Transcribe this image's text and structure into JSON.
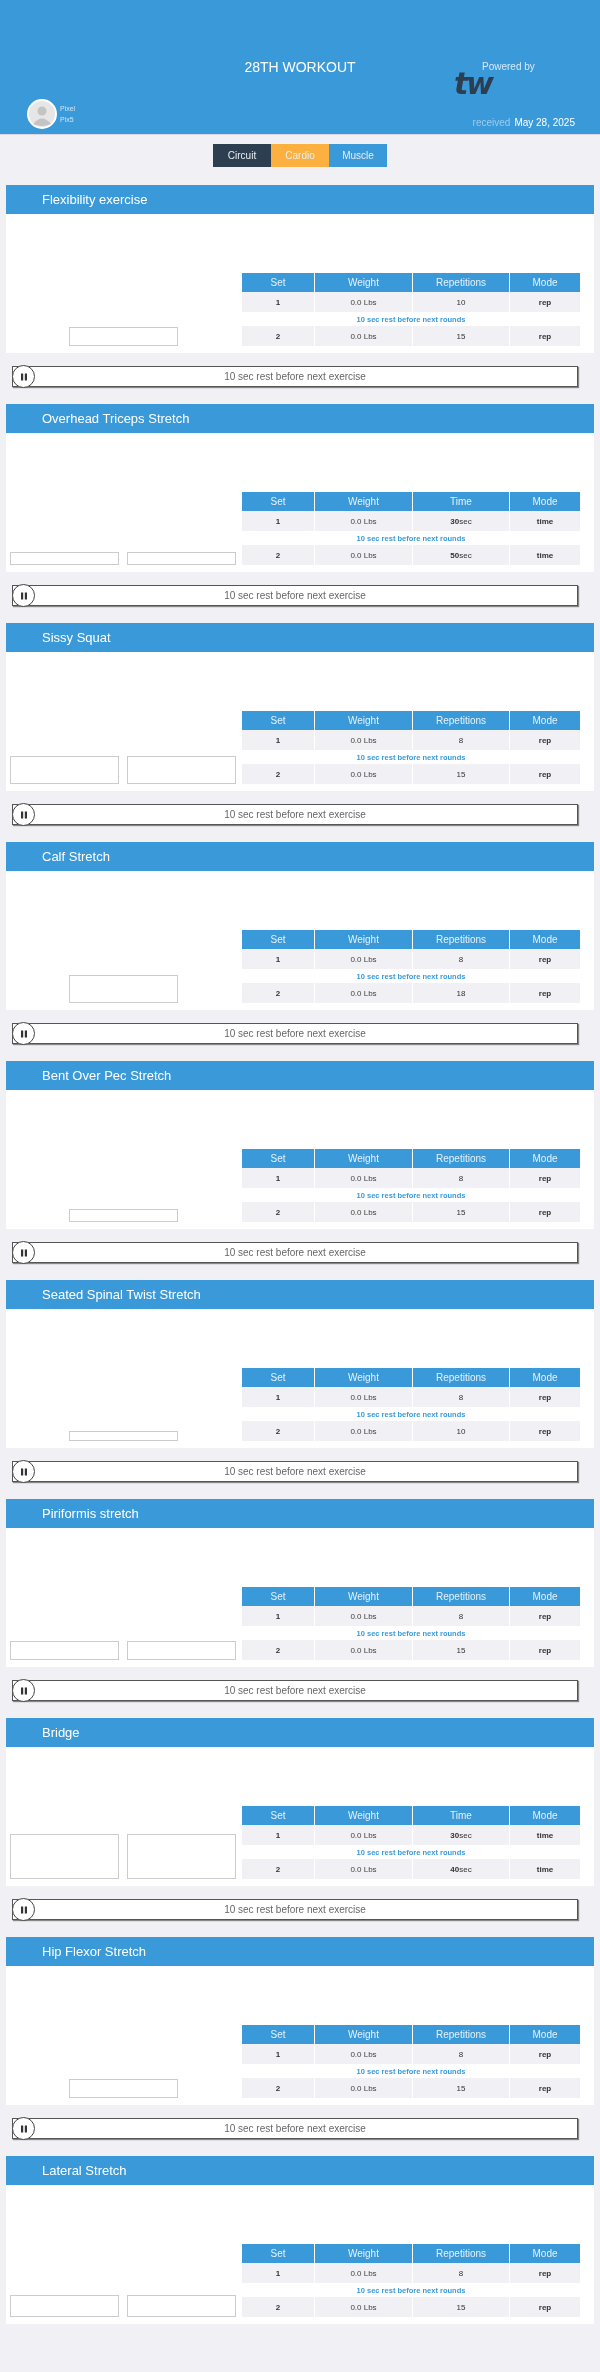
{
  "header": {
    "title": "28TH WORKOUT",
    "user_first": "Pixel",
    "user_last": "Pix5",
    "powered_by": "Powered by",
    "logo_text": "tw",
    "received_label": "received",
    "received_date": "May 28, 2025"
  },
  "tabs": [
    {
      "label": "Circuit",
      "color": "#2c3e50"
    },
    {
      "label": "Cardio",
      "color": "#fbb040"
    },
    {
      "label": "Muscle",
      "color": "#3a9ad9"
    }
  ],
  "exercises": [
    {
      "name": "Flexibility exercise",
      "images": [
        {
          "kind": "short"
        }
      ],
      "columns": [
        "Set",
        "Weight",
        "Repetitions",
        "Mode"
      ],
      "rows": [
        {
          "kind": "set",
          "set": "1",
          "weight": "0.0 Lbs",
          "amount": "10",
          "mode": "rep"
        },
        {
          "kind": "rest",
          "text": "10 sec rest before next rounds"
        },
        {
          "kind": "set",
          "set": "2",
          "weight": "0.0 Lbs",
          "amount": "15",
          "mode": "rep"
        }
      ],
      "rest_after": "10 sec rest before next exercise"
    },
    {
      "name": "Overhead Triceps Stretch",
      "images": [
        {
          "kind": "thin"
        },
        {
          "kind": "thin"
        }
      ],
      "columns": [
        "Set",
        "Weight",
        "Time",
        "Mode"
      ],
      "rows": [
        {
          "kind": "set",
          "set": "1",
          "weight": "0.0 Lbs",
          "amount": "**30**sec",
          "mode": "time"
        },
        {
          "kind": "rest",
          "text": "10 sec rest before next rounds"
        },
        {
          "kind": "set",
          "set": "2",
          "weight": "0.0 Lbs",
          "amount": "**50**sec",
          "mode": "time"
        }
      ],
      "rest_after": "10 sec rest before next exercise"
    },
    {
      "name": "Sissy Squat",
      "images": [
        {
          "kind": "medium"
        },
        {
          "kind": "medium"
        }
      ],
      "columns": [
        "Set",
        "Weight",
        "Repetitions",
        "Mode"
      ],
      "rows": [
        {
          "kind": "set",
          "set": "1",
          "weight": "0.0 Lbs",
          "amount": "8",
          "mode": "rep"
        },
        {
          "kind": "rest",
          "text": "10 sec rest before next rounds"
        },
        {
          "kind": "set",
          "set": "2",
          "weight": "0.0 Lbs",
          "amount": "15",
          "mode": "rep"
        }
      ],
      "rest_after": "10 sec rest before next exercise"
    },
    {
      "name": "Calf Stretch",
      "images": [
        {
          "kind": "medium"
        }
      ],
      "columns": [
        "Set",
        "Weight",
        "Repetitions",
        "Mode"
      ],
      "rows": [
        {
          "kind": "set",
          "set": "1",
          "weight": "0.0 Lbs",
          "amount": "8",
          "mode": "rep"
        },
        {
          "kind": "rest",
          "text": "10 sec rest before next rounds"
        },
        {
          "kind": "set",
          "set": "2",
          "weight": "0.0 Lbs",
          "amount": "18",
          "mode": "rep"
        }
      ],
      "rest_after": "10 sec rest before next exercise"
    },
    {
      "name": "Bent Over Pec Stretch",
      "images": [
        {
          "kind": "thin"
        }
      ],
      "columns": [
        "Set",
        "Weight",
        "Repetitions",
        "Mode"
      ],
      "rows": [
        {
          "kind": "set",
          "set": "1",
          "weight": "0.0 Lbs",
          "amount": "8",
          "mode": "rep"
        },
        {
          "kind": "rest",
          "text": "10 sec rest before next rounds"
        },
        {
          "kind": "set",
          "set": "2",
          "weight": "0.0 Lbs",
          "amount": "15",
          "mode": "rep"
        }
      ],
      "rest_after": "10 sec rest before next exercise"
    },
    {
      "name": "Seated Spinal Twist Stretch",
      "images": [
        {
          "kind": "tiny"
        }
      ],
      "columns": [
        "Set",
        "Weight",
        "Repetitions",
        "Mode"
      ],
      "rows": [
        {
          "kind": "set",
          "set": "1",
          "weight": "0.0 Lbs",
          "amount": "8",
          "mode": "rep"
        },
        {
          "kind": "rest",
          "text": "10 sec rest before next rounds"
        },
        {
          "kind": "set",
          "set": "2",
          "weight": "0.0 Lbs",
          "amount": "10",
          "mode": "rep"
        }
      ],
      "rest_after": "10 sec rest before next exercise"
    },
    {
      "name": "Piriformis stretch",
      "images": [
        {
          "kind": "short"
        },
        {
          "kind": "short"
        }
      ],
      "columns": [
        "Set",
        "Weight",
        "Repetitions",
        "Mode"
      ],
      "rows": [
        {
          "kind": "set",
          "set": "1",
          "weight": "0.0 Lbs",
          "amount": "8",
          "mode": "rep"
        },
        {
          "kind": "rest",
          "text": "10 sec rest before next rounds"
        },
        {
          "kind": "set",
          "set": "2",
          "weight": "0.0 Lbs",
          "amount": "15",
          "mode": "rep"
        }
      ],
      "rest_after": "10 sec rest before next exercise"
    },
    {
      "name": "Bridge",
      "images": [
        {
          "kind": "tall"
        },
        {
          "kind": "tall"
        }
      ],
      "columns": [
        "Set",
        "Weight",
        "Time",
        "Mode"
      ],
      "rows": [
        {
          "kind": "set",
          "set": "1",
          "weight": "0.0 Lbs",
          "amount": "**30**sec",
          "mode": "time"
        },
        {
          "kind": "rest",
          "text": "10 sec rest before next rounds"
        },
        {
          "kind": "set",
          "set": "2",
          "weight": "0.0 Lbs",
          "amount": "**40**sec",
          "mode": "time"
        }
      ],
      "rest_after": "10 sec rest before next exercise"
    },
    {
      "name": "Hip Flexor Stretch",
      "images": [
        {
          "kind": "short"
        }
      ],
      "columns": [
        "Set",
        "Weight",
        "Repetitions",
        "Mode"
      ],
      "rows": [
        {
          "kind": "set",
          "set": "1",
          "weight": "0.0 Lbs",
          "amount": "8",
          "mode": "rep"
        },
        {
          "kind": "rest",
          "text": "10 sec rest before next rounds"
        },
        {
          "kind": "set",
          "set": "2",
          "weight": "0.0 Lbs",
          "amount": "15",
          "mode": "rep"
        }
      ],
      "rest_after": "10 sec rest before next exercise"
    },
    {
      "name": "Lateral Stretch",
      "images": [
        {
          "kind": "small"
        },
        {
          "kind": "small"
        }
      ],
      "columns": [
        "Set",
        "Weight",
        "Repetitions",
        "Mode"
      ],
      "rows": [
        {
          "kind": "set",
          "set": "1",
          "weight": "0.0 Lbs",
          "amount": "8",
          "mode": "rep"
        },
        {
          "kind": "rest",
          "text": "10 sec rest before next rounds"
        },
        {
          "kind": "set",
          "set": "2",
          "weight": "0.0 Lbs",
          "amount": "15",
          "mode": "rep"
        }
      ]
    }
  ]
}
